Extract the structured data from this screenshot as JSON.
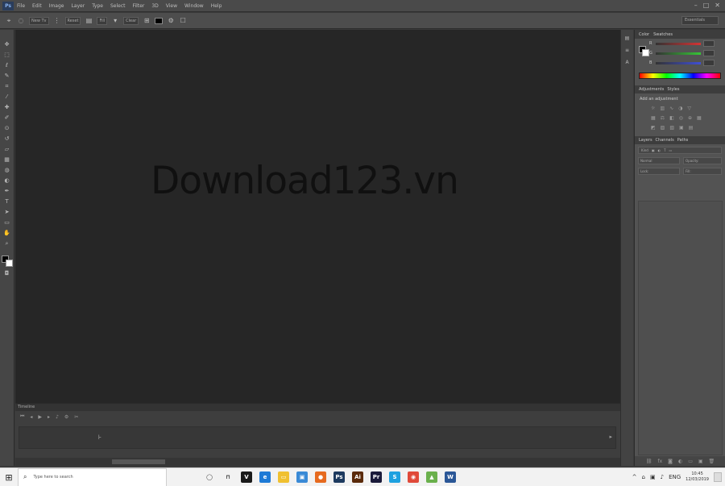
{
  "app": {
    "logo": "Ps",
    "menu": [
      "File",
      "Edit",
      "Image",
      "Layer",
      "Type",
      "Select",
      "Filter",
      "3D",
      "View",
      "Window",
      "Help"
    ],
    "window_controls": [
      "–",
      "□",
      "✕"
    ]
  },
  "options_bar": {
    "fields": [
      "New Tv",
      "Reset",
      "Fill",
      "Clear"
    ],
    "workspace": "Essentials"
  },
  "canvas": {
    "watermark": "Download123.vn",
    "background": "#262626"
  },
  "tools": [
    "move",
    "marquee",
    "lasso",
    "quick-select",
    "crop",
    "eyedropper",
    "healing",
    "brush",
    "clone",
    "history",
    "eraser",
    "gradient",
    "blur",
    "dodge",
    "pen",
    "type",
    "path-select",
    "shape",
    "hand",
    "zoom"
  ],
  "panels": {
    "color": {
      "tabs": [
        "Color",
        "Swatches"
      ],
      "rows": [
        "R",
        "G",
        "B"
      ]
    },
    "adjustments": {
      "tabs": [
        "Adjustments",
        "Styles"
      ],
      "title": "Add an adjustment"
    },
    "layers": {
      "tabs": [
        "Layers",
        "Channels",
        "Paths"
      ],
      "kind": "Kind",
      "blend_mode": "Normal",
      "opacity_label": "Opacity:",
      "lock_label": "Lock:",
      "fill_label": "Fill:"
    }
  },
  "timeline": {
    "tab": "Timeline"
  },
  "taskbar": {
    "search_placeholder": "Type here to search",
    "apps": [
      {
        "name": "task-view",
        "color": "#f2f2f2",
        "glyph": "◯"
      },
      {
        "name": "cortana",
        "color": "#f2f2f2",
        "glyph": "⊓"
      },
      {
        "name": "app-v",
        "color": "#1a1a1a",
        "glyph": "V"
      },
      {
        "name": "edge",
        "color": "#1e7ad6",
        "glyph": "e"
      },
      {
        "name": "file-explorer",
        "color": "#f0c030",
        "glyph": "▭"
      },
      {
        "name": "store",
        "color": "#3a8ad6",
        "glyph": "▣"
      },
      {
        "name": "firefox",
        "color": "#e66a1f",
        "glyph": "●"
      },
      {
        "name": "photoshop",
        "color": "#1d3a5f",
        "glyph": "Ps"
      },
      {
        "name": "illustrator",
        "color": "#5a2a0a",
        "glyph": "Ai"
      },
      {
        "name": "premiere",
        "color": "#1b1b3a",
        "glyph": "Pr"
      },
      {
        "name": "skype",
        "color": "#1ea1e0",
        "glyph": "S"
      },
      {
        "name": "chrome",
        "color": "#e04a3a",
        "glyph": "◉"
      },
      {
        "name": "android",
        "color": "#6ab04c",
        "glyph": "▲"
      },
      {
        "name": "word",
        "color": "#2b5797",
        "glyph": "W"
      }
    ],
    "tray": [
      "^",
      "⌂",
      "▣",
      "♪",
      "ENG"
    ],
    "time": "10:45",
    "date": "12/03/2019"
  }
}
